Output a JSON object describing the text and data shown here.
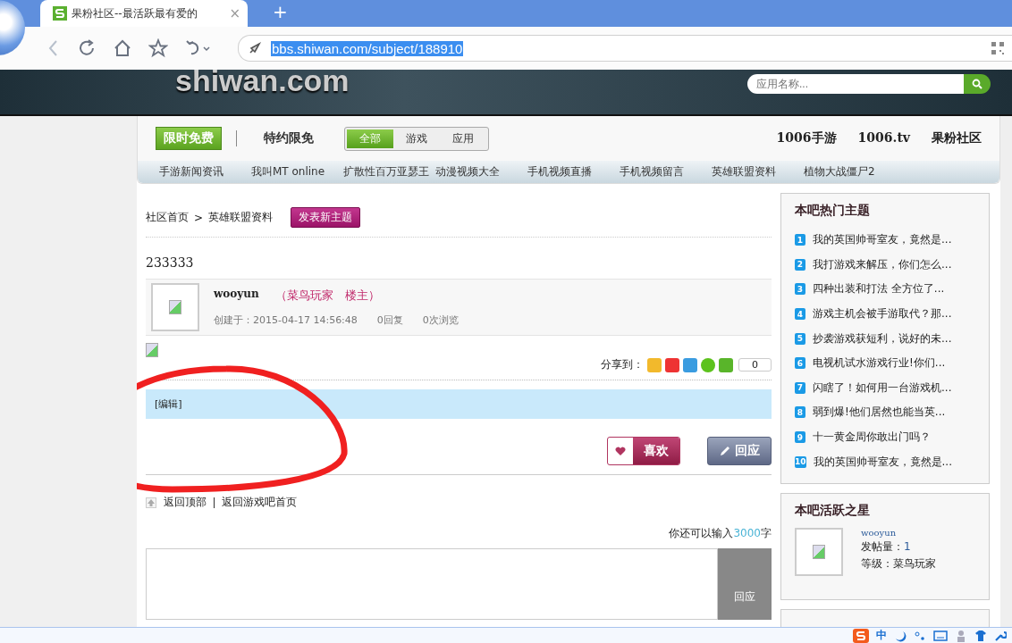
{
  "browser": {
    "tab_title": "果粉社区--最活跃最有爱的",
    "tab_close": "×",
    "new_tab": "+",
    "url": "bbs.shiwan.com/subject/188910"
  },
  "header": {
    "logo": "shiwan.com",
    "search_placeholder": "应用名称..."
  },
  "nav": {
    "promo_button": "限时免费",
    "special": "特约限免",
    "segments": [
      {
        "label": "全部",
        "selected": true
      },
      {
        "label": "游戏",
        "selected": false
      },
      {
        "label": "应用",
        "selected": false
      }
    ],
    "right_links": [
      "1006手游",
      "1006.tv",
      "果粉社区"
    ],
    "sub_links": [
      "手游新闻资讯",
      "我叫MT online",
      "扩散性百万亚瑟王",
      "动漫视频大全",
      "手机视频直播",
      "手机视频留言",
      "英雄联盟资料",
      "植物大战僵尸2"
    ]
  },
  "breadcrumb": {
    "items": [
      "社区首页",
      "英雄联盟资料"
    ],
    "separator": ">",
    "new_topic_button": "发表新主题"
  },
  "post": {
    "title": "233333",
    "author": "wooyun",
    "tags": "（菜鸟玩家　楼主）",
    "created": "创建于：2015-04-17 14:56:48",
    "replies": "0回复",
    "views": "0次浏览",
    "share_label": "分享到：",
    "share_count": "0",
    "edit_link": "[编辑]",
    "like_button": "喜欢",
    "reply_button": "回应"
  },
  "back_links": [
    "返回顶部",
    "返回游戏吧首页"
  ],
  "reply_form": {
    "remaining_prefix": "你还可以输入",
    "remaining_count": "3000",
    "remaining_suffix": "字",
    "submit": "回应"
  },
  "hot_topics": {
    "title": "本吧热门主题",
    "items": [
      {
        "num": "1",
        "text": "我的英国帅哥室友，竟然是..."
      },
      {
        "num": "2",
        "text": "我打游戏来解压，你们怎么..."
      },
      {
        "num": "3",
        "text": "四种出装和打法 全方位了..."
      },
      {
        "num": "4",
        "text": "游戏主机会被手游取代？那..."
      },
      {
        "num": "5",
        "text": "抄袭游戏获短利，说好的未..."
      },
      {
        "num": "6",
        "text": "电视机试水游戏行业!你们..."
      },
      {
        "num": "7",
        "text": "闪瞎了！如何用一台游戏机..."
      },
      {
        "num": "8",
        "text": "弱到爆!他们居然也能当英..."
      },
      {
        "num": "9",
        "text": "十一黄金周你敢出门吗？"
      },
      {
        "num": "10",
        "text": "我的英国帅哥室友，竟然是..."
      }
    ]
  },
  "active_star": {
    "title": "本吧活跃之星",
    "user": "wooyun",
    "posts_label": "发帖量：",
    "posts": "1",
    "level": "等级：菜鸟玩家"
  },
  "ime_bar": {
    "mode": "中"
  }
}
